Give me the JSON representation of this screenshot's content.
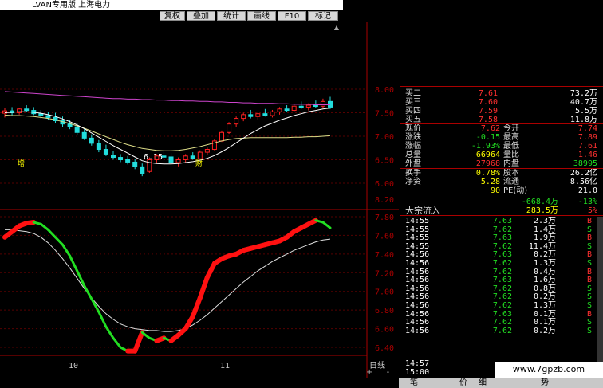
{
  "window": {
    "title": "LVAN专用版  上海电力"
  },
  "toolbar": {
    "buttons": [
      "复权",
      "叠加",
      "统计",
      "画线",
      "F10",
      "标记"
    ]
  },
  "colors": {
    "up": "#ff2020",
    "down": "#22dddd",
    "green": "#22dd22",
    "yellow": "#ffff00",
    "white": "#ffffff",
    "axis": "#aa0000"
  },
  "main_axis": {
    "ticks": [
      "8.00",
      "7.50",
      "7.00",
      "6.50",
      "6.00",
      "8.20"
    ]
  },
  "main_chart": {
    "low_label": "6.15",
    "mark1": "增",
    "mark2": "财",
    "candles": [
      {
        "o": 7.49,
        "h": 7.6,
        "l": 7.4,
        "c": 7.54
      },
      {
        "o": 7.54,
        "h": 7.62,
        "l": 7.45,
        "c": 7.5
      },
      {
        "o": 7.5,
        "h": 7.6,
        "l": 7.46,
        "c": 7.58
      },
      {
        "o": 7.58,
        "h": 7.66,
        "l": 7.52,
        "c": 7.55
      },
      {
        "o": 7.55,
        "h": 7.62,
        "l": 7.45,
        "c": 7.48
      },
      {
        "o": 7.48,
        "h": 7.56,
        "l": 7.38,
        "c": 7.44
      },
      {
        "o": 7.44,
        "h": 7.52,
        "l": 7.34,
        "c": 7.4
      },
      {
        "o": 7.4,
        "h": 7.5,
        "l": 7.28,
        "c": 7.33
      },
      {
        "o": 7.33,
        "h": 7.42,
        "l": 7.2,
        "c": 7.26
      },
      {
        "o": 7.26,
        "h": 7.34,
        "l": 7.15,
        "c": 7.2
      },
      {
        "o": 7.2,
        "h": 7.28,
        "l": 7.02,
        "c": 7.08
      },
      {
        "o": 7.08,
        "h": 7.15,
        "l": 6.92,
        "c": 6.96
      },
      {
        "o": 6.96,
        "h": 7.04,
        "l": 6.8,
        "c": 6.85
      },
      {
        "o": 6.85,
        "h": 6.92,
        "l": 6.66,
        "c": 6.72
      },
      {
        "o": 6.72,
        "h": 6.82,
        "l": 6.58,
        "c": 6.62
      },
      {
        "o": 6.6,
        "h": 6.68,
        "l": 6.5,
        "c": 6.55
      },
      {
        "o": 6.55,
        "h": 6.62,
        "l": 6.45,
        "c": 6.5
      },
      {
        "o": 6.5,
        "h": 6.58,
        "l": 6.4,
        "c": 6.45
      },
      {
        "o": 6.45,
        "h": 6.52,
        "l": 6.3,
        "c": 6.35
      },
      {
        "o": 6.35,
        "h": 6.42,
        "l": 6.15,
        "c": 6.2
      },
      {
        "o": 6.25,
        "h": 6.55,
        "l": 6.22,
        "c": 6.5
      },
      {
        "o": 6.5,
        "h": 6.62,
        "l": 6.42,
        "c": 6.58
      },
      {
        "o": 6.58,
        "h": 6.7,
        "l": 6.48,
        "c": 6.56
      },
      {
        "o": 6.56,
        "h": 6.64,
        "l": 6.4,
        "c": 6.44
      },
      {
        "o": 6.44,
        "h": 6.55,
        "l": 6.36,
        "c": 6.5
      },
      {
        "o": 6.5,
        "h": 6.62,
        "l": 6.45,
        "c": 6.58
      },
      {
        "o": 6.58,
        "h": 6.66,
        "l": 6.5,
        "c": 6.52
      },
      {
        "o": 6.52,
        "h": 6.7,
        "l": 6.5,
        "c": 6.66
      },
      {
        "o": 6.66,
        "h": 6.76,
        "l": 6.6,
        "c": 6.72
      },
      {
        "o": 6.72,
        "h": 6.94,
        "l": 6.7,
        "c": 6.9
      },
      {
        "o": 6.9,
        "h": 7.12,
        "l": 6.88,
        "c": 7.08
      },
      {
        "o": 7.08,
        "h": 7.3,
        "l": 7.05,
        "c": 7.26
      },
      {
        "o": 7.26,
        "h": 7.42,
        "l": 7.2,
        "c": 7.38
      },
      {
        "o": 7.38,
        "h": 7.5,
        "l": 7.32,
        "c": 7.46
      },
      {
        "o": 7.46,
        "h": 7.56,
        "l": 7.38,
        "c": 7.42
      },
      {
        "o": 7.42,
        "h": 7.52,
        "l": 7.36,
        "c": 7.48
      },
      {
        "o": 7.48,
        "h": 7.58,
        "l": 7.42,
        "c": 7.44
      },
      {
        "o": 7.44,
        "h": 7.56,
        "l": 7.4,
        "c": 7.52
      },
      {
        "o": 7.52,
        "h": 7.62,
        "l": 7.46,
        "c": 7.58
      },
      {
        "o": 7.58,
        "h": 7.66,
        "l": 7.52,
        "c": 7.55
      },
      {
        "o": 7.55,
        "h": 7.68,
        "l": 7.52,
        "c": 7.64
      },
      {
        "o": 7.64,
        "h": 7.74,
        "l": 7.58,
        "c": 7.62
      },
      {
        "o": 7.62,
        "h": 7.7,
        "l": 7.55,
        "c": 7.66
      },
      {
        "o": 7.66,
        "h": 7.76,
        "l": 7.6,
        "c": 7.64
      },
      {
        "o": 7.64,
        "h": 7.8,
        "l": 7.6,
        "c": 7.74
      },
      {
        "o": 7.74,
        "h": 7.84,
        "l": 7.58,
        "c": 7.62
      }
    ],
    "ma_fast": [
      7.5,
      7.51,
      7.52,
      7.52,
      7.51,
      7.49,
      7.46,
      7.42,
      7.37,
      7.31,
      7.24,
      7.16,
      7.07,
      6.98,
      6.89,
      6.8,
      6.72,
      6.64,
      6.56,
      6.48,
      6.44,
      6.42,
      6.41,
      6.41,
      6.42,
      6.44,
      6.46,
      6.49,
      6.53,
      6.59,
      6.67,
      6.76,
      6.86,
      6.96,
      7.06,
      7.14,
      7.22,
      7.28,
      7.34,
      7.39,
      7.44,
      7.48,
      7.52,
      7.55,
      7.58,
      7.6
    ],
    "ma_slow": [
      7.45,
      7.44,
      7.44,
      7.43,
      7.42,
      7.4,
      7.38,
      7.35,
      7.31,
      7.27,
      7.22,
      7.17,
      7.11,
      7.05,
      6.99,
      6.93,
      6.87,
      6.82,
      6.78,
      6.74,
      6.72,
      6.7,
      6.69,
      6.69,
      6.7,
      6.72,
      6.75,
      6.78,
      6.82,
      6.86,
      6.9,
      6.93,
      6.95,
      6.96,
      6.97,
      6.97,
      6.97,
      6.97,
      6.97,
      6.97,
      6.98,
      6.98,
      6.99,
      6.99,
      7.0,
      7.01
    ],
    "ma_purple": [
      7.95,
      7.94,
      7.93,
      7.92,
      7.91,
      7.9,
      7.89,
      7.88,
      7.87,
      7.86,
      7.85,
      7.84,
      7.83,
      7.82,
      7.81,
      7.8,
      7.8,
      7.79,
      7.79,
      7.78,
      7.78,
      7.77,
      7.77,
      7.76,
      7.76,
      7.75,
      7.75,
      7.74,
      7.74,
      7.73,
      7.73,
      7.72,
      7.72,
      7.71,
      7.71,
      7.7,
      7.7,
      7.7,
      7.69,
      7.69,
      7.68,
      7.68,
      7.68,
      7.67,
      7.67,
      7.67
    ]
  },
  "lower_chart": {
    "ticks": [
      "7.80",
      "7.60",
      "7.40",
      "7.20",
      "7.00",
      "6.80",
      "6.60",
      "6.40"
    ],
    "x_labels": [
      "10",
      "11"
    ],
    "period_label": "日线",
    "zoom_buttons": [
      "+",
      "-"
    ],
    "indicator": [
      7.58,
      7.64,
      7.7,
      7.73,
      7.74,
      7.72,
      7.66,
      7.58,
      7.5,
      7.38,
      7.22,
      7.06,
      6.92,
      6.78,
      6.62,
      6.5,
      6.4,
      6.36,
      6.36,
      6.56,
      6.5,
      6.47,
      6.5,
      6.47,
      6.53,
      6.6,
      6.73,
      6.93,
      7.15,
      7.3,
      7.35,
      7.38,
      7.4,
      7.44,
      7.46,
      7.48,
      7.5,
      7.52,
      7.54,
      7.58,
      7.64,
      7.68,
      7.72,
      7.76,
      7.74,
      7.68
    ],
    "signal": [
      7.66,
      7.66,
      7.65,
      7.64,
      7.62,
      7.58,
      7.52,
      7.44,
      7.35,
      7.25,
      7.14,
      7.03,
      6.93,
      6.84,
      6.76,
      6.7,
      6.65,
      6.62,
      6.6,
      6.59,
      6.58,
      6.58,
      6.57,
      6.57,
      6.58,
      6.6,
      6.64,
      6.69,
      6.75,
      6.82,
      6.89,
      6.96,
      7.03,
      7.1,
      7.16,
      7.22,
      7.27,
      7.32,
      7.36,
      7.4,
      7.44,
      7.47,
      7.5,
      7.53,
      7.55,
      7.56
    ]
  },
  "quote": {
    "book": [
      {
        "label": "买二",
        "price": "7.61",
        "vol": "73.2万"
      },
      {
        "label": "买三",
        "price": "7.60",
        "vol": "40.7万"
      },
      {
        "label": "买四",
        "price": "7.59",
        "vol": "5.5万"
      },
      {
        "label": "买五",
        "price": "7.58",
        "vol": "11.8万"
      }
    ],
    "stats": [
      {
        "l1": "现价",
        "v1": "7.62",
        "c1": "#ff3030",
        "l2": "今开",
        "v2": "7.74",
        "c2": "#ff3030"
      },
      {
        "l1": "涨跌",
        "v1": "-0.15",
        "c1": "#22dd22",
        "l2": "最高",
        "v2": "7.89",
        "c2": "#ff3030"
      },
      {
        "l1": "涨幅",
        "v1": "-1.93%",
        "c1": "#22dd22",
        "l2": "最低",
        "v2": "7.61",
        "c2": "#ff3030"
      },
      {
        "l1": "总量",
        "v1": "66964",
        "c1": "#ffff00",
        "l2": "量比",
        "v2": "1.46",
        "c2": "#ff3030"
      },
      {
        "l1": "外盘",
        "v1": "27968",
        "c1": "#ff3030",
        "l2": "内盘",
        "v2": "38995",
        "c2": "#22dd22"
      }
    ],
    "stats2": [
      {
        "l1": "换手",
        "v1": "0.78%",
        "c1": "#ffff00",
        "l2": "股本",
        "v2": "26.2亿",
        "c2": "#ffffff"
      },
      {
        "l1": "净资",
        "v1": "5.28",
        "c1": "#ffff00",
        "l2": "流通",
        "v2": "8.56亿",
        "c2": "#ffffff"
      },
      {
        "l1": "",
        "v1": "90",
        "c1": "#ffff00",
        "l2": "PE(动)",
        "v2": "21.0",
        "c2": "#ffffff"
      }
    ],
    "flow_line": {
      "v1": "-668.4万",
      "v2": "-13%"
    },
    "block": {
      "label": "大宗流入",
      "value": "283.5万",
      "pct": "5%"
    },
    "ticks": [
      {
        "t": "14:55",
        "p": "7.63",
        "v": "2.3万",
        "s": "B"
      },
      {
        "t": "14:55",
        "p": "7.62",
        "v": "1.4万",
        "s": "S"
      },
      {
        "t": "14:55",
        "p": "7.63",
        "v": "1.9万",
        "s": "B"
      },
      {
        "t": "14:55",
        "p": "7.62",
        "v": "11.4万",
        "s": "S"
      },
      {
        "t": "14:56",
        "p": "7.63",
        "v": "0.2万",
        "s": "B"
      },
      {
        "t": "14:56",
        "p": "7.62",
        "v": "1.3万",
        "s": "S"
      },
      {
        "t": "14:56",
        "p": "7.62",
        "v": "0.4万",
        "s": "B"
      },
      {
        "t": "14:56",
        "p": "7.63",
        "v": "1.6万",
        "s": "B"
      },
      {
        "t": "14:56",
        "p": "7.62",
        "v": "0.8万",
        "s": "S"
      },
      {
        "t": "14:56",
        "p": "7.62",
        "v": "0.2万",
        "s": "S"
      },
      {
        "t": "14:56",
        "p": "7.62",
        "v": "1.3万",
        "s": "S"
      },
      {
        "t": "14:56",
        "p": "7.63",
        "v": "0.1万",
        "s": "B"
      },
      {
        "t": "14:56",
        "p": "7.62",
        "v": "0.1万",
        "s": "S"
      },
      {
        "t": "14:56",
        "p": "7.62",
        "v": "0.2万",
        "s": "S"
      }
    ],
    "tail_times": [
      "14:57",
      "15:00"
    ]
  },
  "bottom_tabs": [
    "笔",
    "价",
    "细",
    "势"
  ],
  "watermark": "www.7gpzb.com"
}
